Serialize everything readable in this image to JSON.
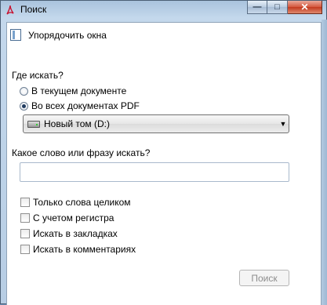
{
  "window": {
    "title": "Поиск",
    "app_icon": "pdf-icon"
  },
  "caption": {
    "minimize": "minimize-icon",
    "maximize": "maximize-icon",
    "close": "close-icon"
  },
  "arrange": {
    "label": "Упорядочить окна",
    "icon": "arrange-windows-icon"
  },
  "where": {
    "heading": "Где искать?",
    "options": [
      {
        "label": "В текущем документе",
        "checked": false
      },
      {
        "label": "Во всех документах PDF",
        "checked": true
      }
    ],
    "location": {
      "value": "Новый том (D:)",
      "icon": "drive-icon"
    }
  },
  "query": {
    "heading": "Какое слово или фразу искать?",
    "value": ""
  },
  "options": [
    {
      "label": "Только слова целиком",
      "checked": false
    },
    {
      "label": "С учетом регистра",
      "checked": false
    },
    {
      "label": "Искать в закладках",
      "checked": false
    },
    {
      "label": "Искать в комментариях",
      "checked": false
    }
  ],
  "search_button": {
    "label": "Поиск",
    "enabled": false
  }
}
